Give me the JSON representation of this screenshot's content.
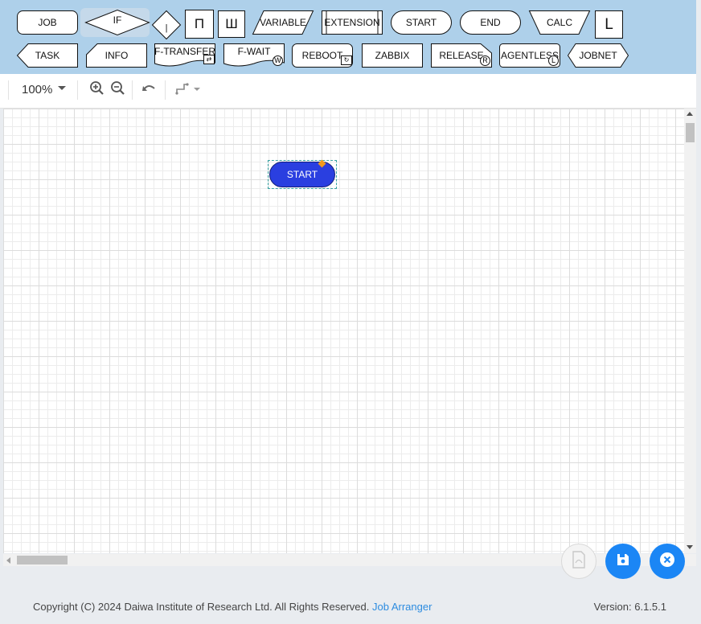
{
  "palette": {
    "items": [
      {
        "label": "JOB"
      },
      {
        "label": "IF"
      },
      {
        "label": "|"
      },
      {
        "label": "П"
      },
      {
        "label": "Ш"
      },
      {
        "label": "VARIABLE"
      },
      {
        "label": "EXTENSION"
      },
      {
        "label": "START"
      },
      {
        "label": "END"
      },
      {
        "label": "CALC"
      },
      {
        "label": "L"
      },
      {
        "label": "TASK"
      },
      {
        "label": "INFO"
      },
      {
        "label": "F-TRANSFER",
        "badge": "⇄"
      },
      {
        "label": "F-WAIT",
        "badge": "W"
      },
      {
        "label": "REBOOT",
        "badge": "↻"
      },
      {
        "label": "ZABBIX"
      },
      {
        "label": "RELEASE",
        "badge": "R"
      },
      {
        "label": "AGENTLESS",
        "badge": "L"
      },
      {
        "label": "JOBNET"
      }
    ]
  },
  "toolbar": {
    "zoom": "100%",
    "icons": [
      "zoom-in-icon",
      "zoom-out-icon",
      "undo-icon",
      "connector-style-icon"
    ]
  },
  "canvas": {
    "nodes": [
      {
        "label": "START",
        "color": "#2a3fe0",
        "selected": true
      }
    ]
  },
  "actions": {
    "pdf_icon": "pdf-icon",
    "save_icon": "save-icon",
    "close_icon": "close-icon"
  },
  "footer": {
    "copyright": "Copyright (C) 2024 Daiwa Institute of Research Ltd. All Rights Reserved.",
    "product_link": "Job Arranger",
    "version": "Version: 6.1.5.1"
  },
  "colors": {
    "palette_bg": "#aed0ea",
    "start_node": "#2a3fe0",
    "accent": "#1b86f5",
    "selection_handle": "#f29a1d"
  }
}
